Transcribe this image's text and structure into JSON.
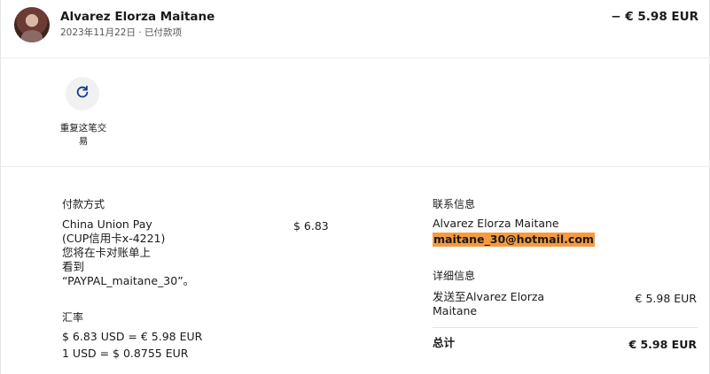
{
  "header": {
    "name": "Alvarez Elorza Maitane",
    "date_status": "2023年11月22日 · 已付款项",
    "amount": "− € 5.98 EUR"
  },
  "actions": {
    "repeat_label": "重复这笔交易",
    "repeat_icon": "refresh-icon"
  },
  "payment": {
    "title": "付款方式",
    "method_lines": [
      "China Union Pay",
      "(CUP信用卡x-4221)",
      "您将在卡对账单上",
      "看到",
      "“PAYPAL_maitane_30”。"
    ],
    "amount": "$ 6.83"
  },
  "exchange": {
    "title": "汇率",
    "line1": "$ 6.83 USD = € 5.98 EUR",
    "line2": "1 USD = $ 0.8755 EUR"
  },
  "contact": {
    "title": "联系信息",
    "name": "Alvarez Elorza Maitane",
    "email": "maitane_30@hotmail.com"
  },
  "details": {
    "title": "详细信息",
    "sent_to_line1": "发送至Alvarez Elorza",
    "sent_to_line2": "Maitane",
    "sent_amount": "€ 5.98 EUR",
    "total_label": "总计",
    "total_amount": "€ 5.98 EUR"
  },
  "colors": {
    "email_highlight": "#f79a3e",
    "divider": "#e3e3e3"
  }
}
